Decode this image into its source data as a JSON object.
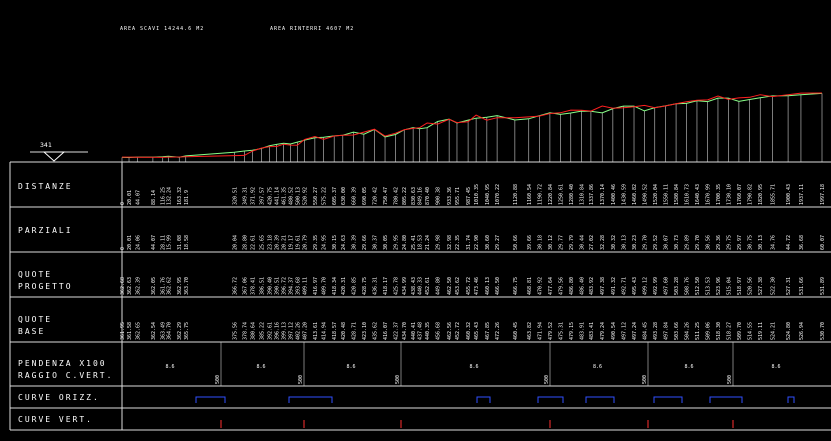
{
  "header": {
    "area_scavi": "AREA SCAVI 14244.6 M2",
    "area_rinterri": "AREA RINTERRI 4607 M2"
  },
  "start_section": "341",
  "rows": {
    "distanze": "DISTANZE",
    "parziali": "PARZIALI",
    "quote_progetto_1": "QUOTE",
    "quote_progetto_2": "PROGETTO",
    "quote_base_1": "QUOTE",
    "quote_base_2": "BASE",
    "pendenza_1": "PENDENZA X100",
    "pendenza_2": "RAGGIO C.VERT.",
    "curve_orizz": "CURVE ORIZZ.",
    "curve_vert": "CURVE VERT."
  },
  "colors": {
    "terrain": "#88ff88",
    "project": "#ff2020",
    "curve_horizontal": "#3050ff",
    "vertical_marker": "#ff3030",
    "grid": "#dddddd"
  },
  "chart_data": {
    "type": "line",
    "title": "",
    "xlabel": "",
    "ylabel": "",
    "sections_x": [
      0,
      20,
      44,
      88,
      116,
      132,
      163,
      177,
      181,
      185,
      189,
      193,
      197,
      201,
      205,
      209,
      213,
      217,
      221,
      225,
      229,
      233,
      237,
      241,
      245,
      249,
      253,
      257,
      261,
      265,
      269,
      273,
      277,
      281,
      285,
      289,
      293,
      297,
      301,
      305,
      309,
      313,
      320,
      349,
      371,
      397,
      420,
      441,
      461,
      480,
      500,
      520,
      550,
      575,
      605,
      630,
      660,
      690,
      720,
      750,
      780,
      805,
      830,
      850,
      870,
      900,
      930,
      955,
      980,
      1010,
      1040,
      1070,
      1100,
      1130,
      1160,
      1190,
      1220,
      1250,
      1280,
      1310,
      1340,
      1370,
      1400,
      1430,
      1460,
      1490,
      1520,
      1550,
      1580,
      1610,
      1640,
      1670,
      1700,
      1730,
      1760,
      1790,
      1820,
      1850,
      1880,
      1910,
      1935,
      1960,
      1980
    ],
    "distanze_labels": [
      "0",
      "20.01",
      "44.07",
      "88.14",
      "116.25",
      "132.24",
      "163.32",
      "181.9",
      "320.51",
      "349.31",
      "371.92",
      "397.57",
      "420.75",
      "441.14",
      "461.35",
      "480.52",
      "500.13",
      "520.92",
      "550.27",
      "575.22",
      "605.37",
      "630.00",
      "660.39",
      "690.05",
      "720.42",
      "750.47",
      "780.42",
      "805.22",
      "830.63",
      "849.16",
      "870.40",
      "900.38",
      "933.36",
      "955.71",
      "987.45",
      "1010.35",
      "1040.95",
      "1070.22",
      "1120.88",
      "1160.54",
      "1190.72",
      "1220.84",
      "1250.61",
      "1280.40",
      "1310.84",
      "1337.86",
      "1370.14",
      "1400.46",
      "1430.59",
      "1460.82",
      "1490.52",
      "1520.04",
      "1550.11",
      "1580.84",
      "1610.73",
      "1640.43",
      "1670.99",
      "1700.35",
      "1730.10",
      "1760.07",
      "1790.82",
      "1820.95",
      "1855.71",
      "1900.43",
      "1937.11",
      "1997.18"
    ],
    "parziali_labels": [
      "0",
      "20.01",
      "24.06",
      "44.07",
      "28.11",
      "15.99",
      "31.08",
      "18.58",
      "20.04",
      "28.80",
      "22.61",
      "25.65",
      "23.18",
      "20.39",
      "20.21",
      "19.17",
      "19.61",
      "20.79",
      "29.35",
      "24.95",
      "30.15",
      "24.63",
      "30.39",
      "29.66",
      "30.37",
      "30.05",
      "29.95",
      "24.80",
      "25.41",
      "18.53",
      "21.24",
      "29.98",
      "32.98",
      "22.35",
      "31.74",
      "22.90",
      "30.60",
      "29.27",
      "50.66",
      "39.66",
      "30.18",
      "30.12",
      "29.77",
      "29.79",
      "30.44",
      "27.02",
      "32.28",
      "30.32",
      "30.13",
      "30.23",
      "29.70",
      "29.52",
      "30.07",
      "30.73",
      "29.89",
      "29.70",
      "30.56",
      "29.36",
      "29.75",
      "29.97",
      "30.75",
      "30.13",
      "34.76",
      "44.72",
      "36.68",
      "60.07"
    ],
    "quote_progetto": [
      "362.68",
      "362.63",
      "362.39",
      "362.05",
      "361.76",
      "362.62",
      "362.95",
      "363.70",
      "366.72",
      "367.06",
      "378.41",
      "386.51",
      "390.40",
      "390.51",
      "396.72",
      "394.37",
      "393.68",
      "409.11",
      "416.97",
      "409.70",
      "418.34",
      "420.31",
      "420.85",
      "428.75",
      "436.31",
      "418.17",
      "425.78",
      "434.99",
      "438.43",
      "440.33",
      "452.61",
      "449.80",
      "462.50",
      "453.62",
      "455.72",
      "473.46",
      "460.13",
      "466.50",
      "466.75",
      "468.81",
      "470.92",
      "477.64",
      "479.56",
      "486.80",
      "486.40",
      "483.92",
      "497.38",
      "491.32",
      "492.71",
      "495.43",
      "499.12",
      "492.99",
      "497.60",
      "503.28",
      "508.76",
      "512.50",
      "513.53",
      "523.96",
      "515.04",
      "518.97",
      "520.56",
      "527.38",
      "522.30",
      "527.31",
      "531.66",
      "531.89"
    ],
    "quote_base": [
      "361.95",
      "361.58",
      "362.65",
      "362.54",
      "363.49",
      "364.70",
      "362.29",
      "365.75",
      "375.56",
      "378.74",
      "380.64",
      "385.22",
      "392.61",
      "396.16",
      "399.13",
      "397.12",
      "402.26",
      "407.20",
      "413.61",
      "414.94",
      "418.57",
      "420.48",
      "428.71",
      "423.10",
      "435.62",
      "416.07",
      "422.37",
      "434.70",
      "440.41",
      "437.48",
      "440.35",
      "456.68",
      "462.56",
      "452.72",
      "460.32",
      "465.43",
      "467.85",
      "472.26",
      "460.45",
      "463.82",
      "471.94",
      "479.52",
      "475.31",
      "479.15",
      "483.91",
      "483.41",
      "479.24",
      "490.54",
      "497.12",
      "497.24",
      "484.45",
      "493.28",
      "497.84",
      "503.66",
      "504.26",
      "511.25",
      "509.06",
      "518.30",
      "518.27",
      "509.70",
      "514.55",
      "519.11",
      "524.21",
      "524.80",
      "526.94",
      "530.70"
    ],
    "pendenza_values": [
      "8.6",
      "8.6",
      "8.6",
      "8.6",
      "8.6",
      "8.6",
      "8.6",
      "8.6"
    ],
    "raggio_values": [
      "500",
      "500",
      "500",
      "500",
      "500",
      "500",
      "500",
      "500"
    ]
  }
}
